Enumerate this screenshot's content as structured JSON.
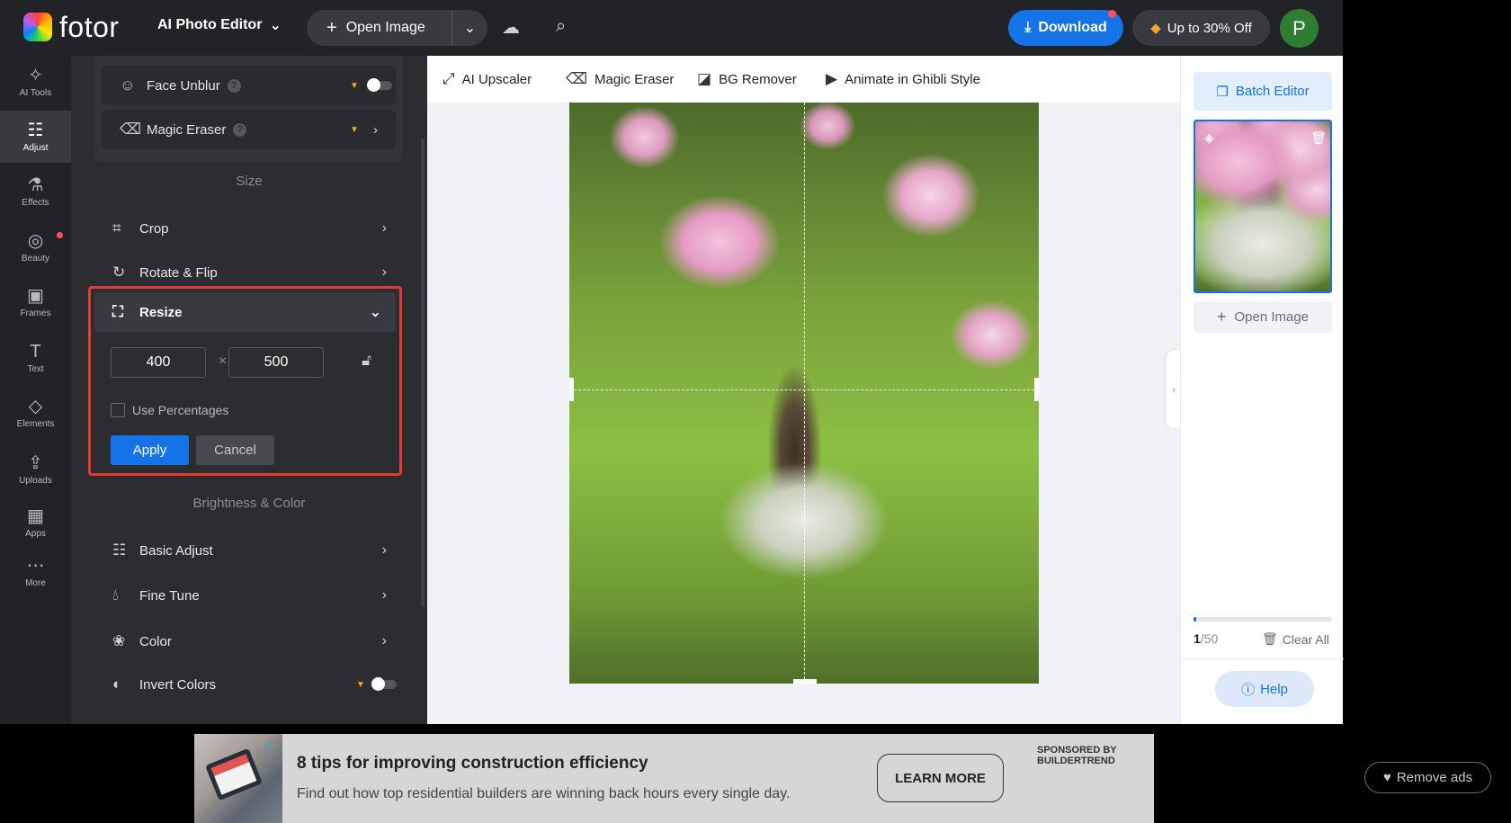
{
  "header": {
    "logo_text": "fotor",
    "editor_menu_label": "AI Photo Editor",
    "open_image_label": "Open Image",
    "download_label": "Download",
    "promo_label": "Up to 30% Off",
    "avatar_initial": "P"
  },
  "rail": {
    "items": [
      {
        "label": "AI Tools",
        "icon": "sparkle-icon"
      },
      {
        "label": "Adjust",
        "icon": "sliders-icon"
      },
      {
        "label": "Effects",
        "icon": "flask-icon"
      },
      {
        "label": "Beauty",
        "icon": "eye-icon"
      },
      {
        "label": "Frames",
        "icon": "frame-icon"
      },
      {
        "label": "Text",
        "icon": "text-icon"
      },
      {
        "label": "Elements",
        "icon": "shapes-icon"
      },
      {
        "label": "Uploads",
        "icon": "cloud-upload-icon"
      },
      {
        "label": "Apps",
        "icon": "apps-icon"
      },
      {
        "label": "More",
        "icon": "more-icon"
      }
    ],
    "active": "Adjust"
  },
  "panel": {
    "subitems": [
      {
        "label": "Face Unblur"
      },
      {
        "label": "Magic Eraser"
      }
    ],
    "size_title": "Size",
    "crop_label": "Crop",
    "rotate_label": "Rotate & Flip",
    "resize": {
      "label": "Resize",
      "width": "400",
      "height": "500",
      "times": "×",
      "use_percentages_label": "Use Percentages",
      "apply_label": "Apply",
      "cancel_label": "Cancel"
    },
    "brightness_title": "Brightness & Color",
    "basic_adjust_label": "Basic Adjust",
    "fine_tune_label": "Fine Tune",
    "color_label": "Color",
    "invert_colors_label": "Invert Colors"
  },
  "toolbar": {
    "tools": [
      {
        "label": "AI Upscaler",
        "icon": "upscale-icon"
      },
      {
        "label": "Magic Eraser",
        "icon": "eraser-icon"
      },
      {
        "label": "BG Remover",
        "icon": "bg-remove-icon"
      },
      {
        "label": "Animate in Ghibli Style",
        "icon": "animate-icon"
      }
    ]
  },
  "right_panel": {
    "batch_editor_label": "Batch Editor",
    "open_image_label": "Open Image",
    "count_current": "1",
    "count_total": "/50",
    "progress_fraction": 0.02,
    "clear_all_label": "Clear All",
    "help_label": "Help"
  },
  "ad": {
    "title": "8 tips for improving construction efficiency",
    "subtitle": "Find out how top residential builders are winning back hours every single day.",
    "cta_label": "LEARN MORE",
    "sponsor_line1": "SPONSORED BY",
    "sponsor_line2": "BUILDERTREND",
    "remove_ads_label": "Remove ads"
  },
  "colors": {
    "accent": "#1473e6",
    "highlight_border": "#e53935",
    "dark_bg": "#222327",
    "panel_bg": "#2c2d31"
  }
}
